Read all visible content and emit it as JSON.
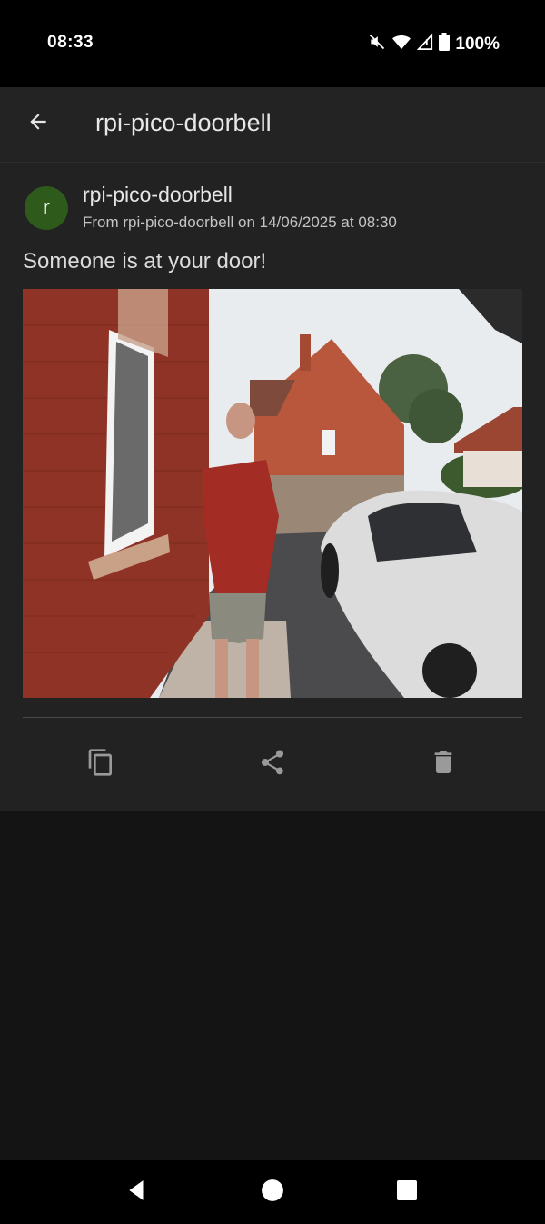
{
  "status_bar": {
    "time": "08:33",
    "battery": "100%",
    "icons": [
      "mute-icon",
      "wifi-icon",
      "signal-icon",
      "battery-icon"
    ]
  },
  "app_bar": {
    "title": "rpi-pico-doorbell",
    "back_icon": "arrow-left-icon"
  },
  "notification": {
    "avatar_letter": "r",
    "avatar_color": "#2e5a1c",
    "title": "rpi-pico-doorbell",
    "meta": "From rpi-pico-doorbell on 14/06/2025 at 08:30",
    "message": "Someone is at your door!",
    "actions": [
      "copy-icon",
      "share-icon",
      "delete-icon"
    ]
  },
  "nav_bar": {
    "buttons": [
      "back-triangle-icon",
      "home-circle-icon",
      "recents-square-icon"
    ]
  }
}
